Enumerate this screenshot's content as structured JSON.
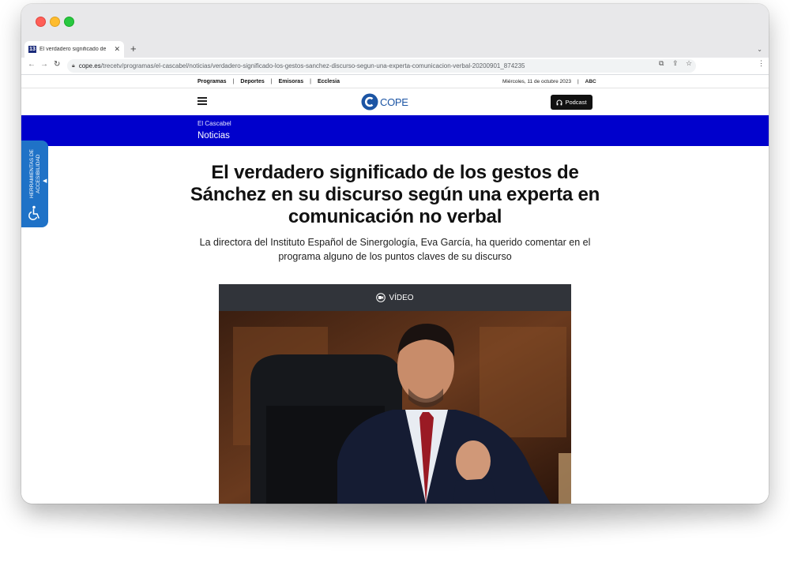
{
  "browser": {
    "tab_title": "El verdadero significado de los gestos",
    "tab_favicon": "13",
    "url_host": "cope.es",
    "url_path": "/trecetv/programas/el-cascabel/noticias/verdadero-significado-los-gestos-sanchez-discurso-segun-una-experta-comunicacion-verbal-20200901_874235"
  },
  "topbar": {
    "nav": [
      "Programas",
      "Deportes",
      "Emisoras",
      "Ecclesia"
    ],
    "date": "Miércoles, 11 de octubre 2023",
    "partner": "ABC"
  },
  "header": {
    "logo_text": "COPE",
    "podcast_label": "Podcast",
    "brand_color": "#1c55a4"
  },
  "section": {
    "kicker": "El Cascabel",
    "title": "Noticias",
    "band_color": "#0000cc"
  },
  "accessibility": {
    "label": "HERRAMIENTAS DE ACCESIBILIDAD"
  },
  "article": {
    "headline": "El verdadero significado de los gestos de Sánchez en su discurso según una experta en comunicación no verbal",
    "subhead": "La directora del Instituto Español de Sinergología, Eva García, ha querido comentar en el programa alguno de los puntos claves de su discurso",
    "video_label": "VÍDEO"
  }
}
